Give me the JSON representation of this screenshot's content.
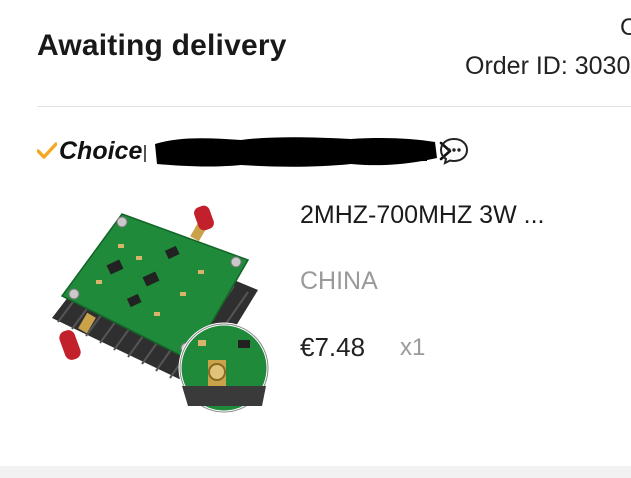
{
  "order": {
    "status": "Awaiting delivery",
    "top_right_fragment": "C",
    "order_id_text": "Order ID: 3030"
  },
  "store": {
    "badge_label": "Choice",
    "badge_icon": "checkmark-icon",
    "name_redacted": true,
    "chat_icon": "chat-bubble-icon"
  },
  "item": {
    "title": "2MHZ-700MHZ 3W ...",
    "ship_from": "CHINA",
    "price": "€7.48",
    "quantity": "x1",
    "image_icon": "rf-amplifier-board-photo"
  },
  "colors": {
    "choice_check": "#f5a623",
    "pcb_green": "#1f8a3a",
    "sma_red": "#c2202a",
    "heatsink": "#3a3a3a",
    "gold": "#c9a24a"
  }
}
